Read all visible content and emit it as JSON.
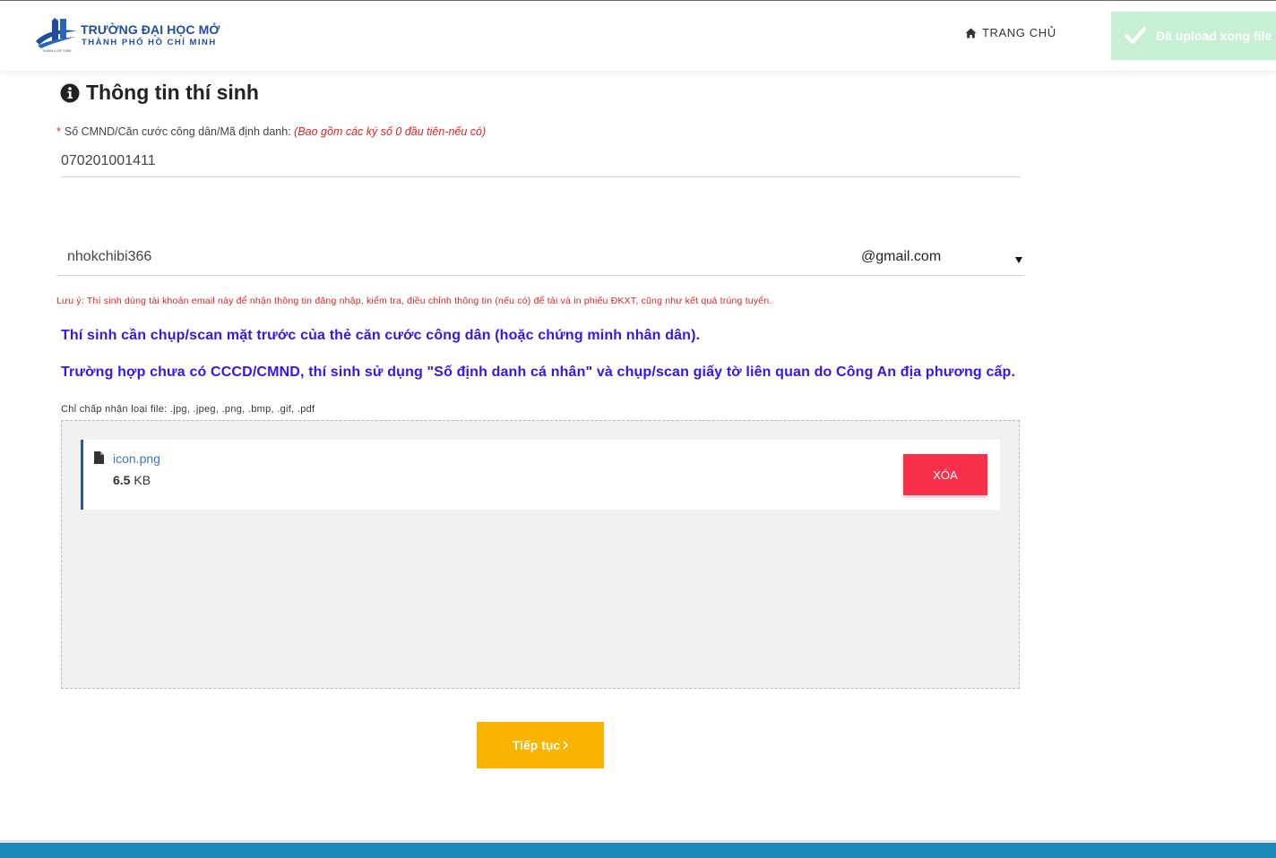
{
  "header": {
    "logo_title": "TRƯỜNG ĐẠI HỌC MỞ",
    "logo_subtitle": "THÀNH PHỐ HỒ CHÍ MINH",
    "logo_tiny": "THÀNH LẬP 1990",
    "nav_home": "TRANG CHỦ"
  },
  "toast": {
    "message": "Đã upload xong file",
    "icon": "check-icon",
    "color": "#c6efd4"
  },
  "page": {
    "title": "Thông tin thí sinh",
    "title_icon": "info-circle-icon"
  },
  "id_field": {
    "required_mark": "*",
    "label": "Số CMND/Căn cước công dân/Mã định danh:",
    "hint": "(Bao gồm các ký số 0 đầu tiên-nếu có)",
    "value": "070201001411"
  },
  "email_field": {
    "username": "nhokchibi366",
    "domain": "@gmail.com"
  },
  "note": "Lưu ý: Thí sinh dùng tài khoản email này để nhận thông tin đăng nhập, kiểm tra, điều chỉnh thông tin (nếu có) để tải và in phiếu ĐKXT, cũng như kết quả trúng tuyển.",
  "instructions": [
    "Thí sinh cần chụp/scan mặt trước của thẻ căn cước công dân (hoặc chứng minh nhân dân).",
    "Trường hợp chưa có CCCD/CMND, thí sinh sử dụng \"Số định danh cá nhân\" và chụp/scan giấy tờ liên quan do Công An địa phương cấp."
  ],
  "upload": {
    "accepted_types": "Chỉ chấp nhận loại file: .jpg, .jpeg, .png, .bmp, .gif, .pdf",
    "file": {
      "name": "icon.png",
      "size_value": "6.5",
      "size_unit": "KB"
    },
    "delete_label": "XÓA"
  },
  "continue_label": "Tiếp tục",
  "colors": {
    "brand_blue": "#1f4e9c",
    "instruction_blue": "#3713ec",
    "danger": "#f8304a",
    "warning_text": "#e02424",
    "continue": "#f8b400",
    "footer": "#1a89b8"
  }
}
